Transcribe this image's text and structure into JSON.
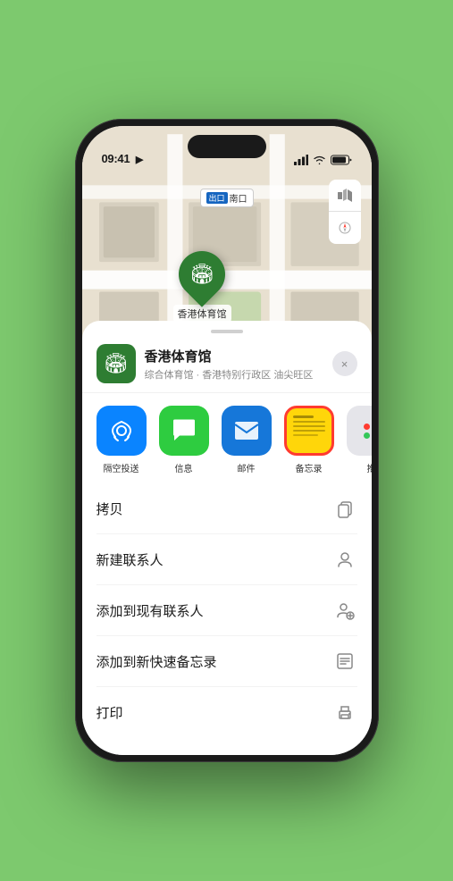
{
  "status": {
    "time": "09:41",
    "location_indicator": "▶"
  },
  "map": {
    "label_tag": "出口",
    "label_text": "南口",
    "layer_icon": "🗺",
    "compass_icon": "◎",
    "controls": [
      {
        "label": "🗺",
        "name": "map-type"
      },
      {
        "label": "⊙",
        "name": "location"
      }
    ]
  },
  "pin": {
    "label": "香港体育馆"
  },
  "sheet": {
    "venue_name": "香港体育馆",
    "venue_desc": "综合体育馆 · 香港特别行政区 油尖旺区",
    "close_label": "×"
  },
  "share_items": [
    {
      "id": "airdrop",
      "label": "隔空投送",
      "icon": "📡"
    },
    {
      "id": "message",
      "label": "信息",
      "icon": "💬"
    },
    {
      "id": "mail",
      "label": "邮件",
      "icon": "✉"
    },
    {
      "id": "notes",
      "label": "备忘录",
      "icon": "📝"
    },
    {
      "id": "more",
      "label": "推",
      "icon": "•••"
    }
  ],
  "actions": [
    {
      "label": "拷贝",
      "icon": "copy",
      "name": "copy-action"
    },
    {
      "label": "新建联系人",
      "icon": "person",
      "name": "new-contact-action"
    },
    {
      "label": "添加到现有联系人",
      "icon": "person-add",
      "name": "add-existing-contact-action"
    },
    {
      "label": "添加到新快速备忘录",
      "icon": "note",
      "name": "add-quick-note-action"
    },
    {
      "label": "打印",
      "icon": "print",
      "name": "print-action"
    }
  ]
}
